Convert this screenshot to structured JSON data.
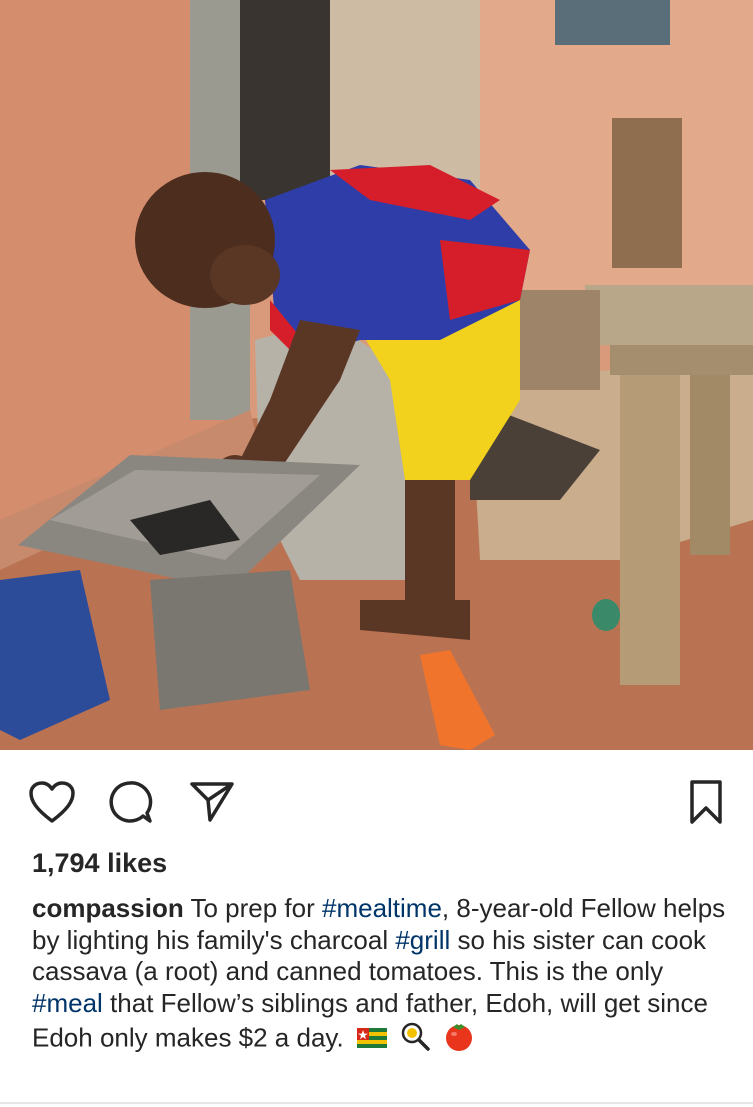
{
  "post": {
    "image_alt": "Boy in red and blue jersey and yellow shorts placing charcoal in a metal grill",
    "likes": "1,794 likes",
    "caption": {
      "username": "compassion",
      "text_1": " To prep for ",
      "tag_1": "#mealtime",
      "text_2": ", 8-year-old Fellow helps by lighting his family's charcoal ",
      "tag_2": "#grill",
      "text_3": " so his sister can cook cassava (a root) and canned tomatoes. This is the only ",
      "tag_3": "#meal",
      "text_4": " that Fellow’s siblings and father, Edoh, will get since Edoh only makes $2 a day."
    }
  },
  "icons": {
    "like": "heart-icon",
    "comment": "comment-icon",
    "share": "paper-plane-icon",
    "save": "bookmark-icon",
    "emoji_1": "togo-flag-icon",
    "emoji_2": "magnifier-icon",
    "emoji_3": "tomato-icon"
  },
  "colors": {
    "text": "#262626",
    "hashtag": "#003569",
    "background": "#ffffff"
  }
}
